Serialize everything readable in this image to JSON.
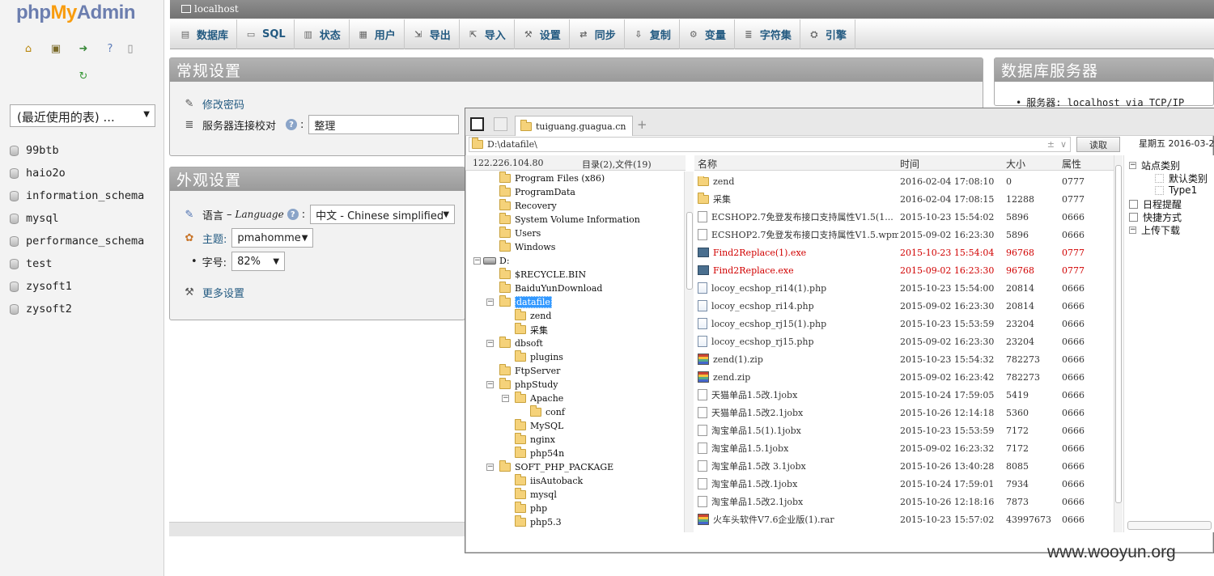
{
  "nav": {
    "logo_php": "php",
    "logo_my": "My",
    "logo_admin": "Admin",
    "recent_tables": "(最近使用的表) ...",
    "databases": [
      "99btb",
      "haio2o",
      "information_schema",
      "mysql",
      "performance_schema",
      "test",
      "zysoft1",
      "zysoft2"
    ],
    "icons": [
      "home-icon",
      "logout-icon",
      "query-window-icon",
      "help-icon",
      "docs-icon",
      "reload-icon"
    ]
  },
  "server_bar": {
    "label": "localhost"
  },
  "tabs": [
    "数据库",
    "SQL",
    "状态",
    "用户",
    "导出",
    "导入",
    "设置",
    "同步",
    "复制",
    "变量",
    "字符集",
    "引擎"
  ],
  "general": {
    "title": "常规设置",
    "change_password": "修改密码",
    "collation_label": "服务器连接校对",
    "collation_value": "整理"
  },
  "appearance": {
    "title": "外观设置",
    "language_label": "语言",
    "language_latin": "Language",
    "language_value": "中文 - Chinese simplified",
    "theme_label": "主题:",
    "theme_value": "pmahomme",
    "font_label": "字号:",
    "font_value": "82%",
    "more_settings": "更多设置"
  },
  "dbserver": {
    "title": "数据库服务器",
    "server_line": "服务器: localhost via TCP/IP"
  },
  "filemanager": {
    "tab_label": "tuiguang.guagua.cn",
    "path": "D:\\datafile\\",
    "read_button": "读取",
    "date_label": "星期五 2016-03-2",
    "ip": "122.226.104.80",
    "counts": "目录(2),文件(19)",
    "columns": {
      "name": "名称",
      "time": "时间",
      "size": "大小",
      "attr": "属性"
    },
    "tree": [
      {
        "label": "Program Files (x86)",
        "depth": 1,
        "kind": "folder"
      },
      {
        "label": "ProgramData",
        "depth": 1,
        "kind": "folder"
      },
      {
        "label": "Recovery",
        "depth": 1,
        "kind": "folder"
      },
      {
        "label": "System Volume Information",
        "depth": 1,
        "kind": "folder"
      },
      {
        "label": "Users",
        "depth": 1,
        "kind": "folder"
      },
      {
        "label": "Windows",
        "depth": 1,
        "kind": "folder"
      },
      {
        "label": "D:",
        "depth": 0,
        "kind": "drive",
        "toggle": "−"
      },
      {
        "label": "$RECYCLE.BIN",
        "depth": 1,
        "kind": "folder"
      },
      {
        "label": "BaiduYunDownload",
        "depth": 1,
        "kind": "folder"
      },
      {
        "label": "datafile",
        "depth": 1,
        "kind": "folder",
        "toggle": "−",
        "selected": true
      },
      {
        "label": "zend",
        "depth": 2,
        "kind": "folder"
      },
      {
        "label": "采集",
        "depth": 2,
        "kind": "folder"
      },
      {
        "label": "dbsoft",
        "depth": 1,
        "kind": "folder",
        "toggle": "−"
      },
      {
        "label": "plugins",
        "depth": 2,
        "kind": "folder"
      },
      {
        "label": "FtpServer",
        "depth": 1,
        "kind": "folder"
      },
      {
        "label": "phpStudy",
        "depth": 1,
        "kind": "folder",
        "toggle": "−"
      },
      {
        "label": "Apache",
        "depth": 2,
        "kind": "folder",
        "toggle": "−"
      },
      {
        "label": "conf",
        "depth": 3,
        "kind": "folder"
      },
      {
        "label": "MySQL",
        "depth": 2,
        "kind": "folder"
      },
      {
        "label": "nginx",
        "depth": 2,
        "kind": "folder"
      },
      {
        "label": "php54n",
        "depth": 2,
        "kind": "folder"
      },
      {
        "label": "SOFT_PHP_PACKAGE",
        "depth": 1,
        "kind": "folder",
        "toggle": "−"
      },
      {
        "label": "iisAutoback",
        "depth": 2,
        "kind": "folder"
      },
      {
        "label": "mysql",
        "depth": 2,
        "kind": "folder"
      },
      {
        "label": "php",
        "depth": 2,
        "kind": "folder"
      },
      {
        "label": "php5.3",
        "depth": 2,
        "kind": "folder"
      }
    ],
    "files": [
      {
        "name": "zend",
        "time": "2016-02-04 17:08:10",
        "size": "0",
        "attr": "0777",
        "type": "folder"
      },
      {
        "name": "采集",
        "time": "2016-02-04 17:08:15",
        "size": "12288",
        "attr": "0777",
        "type": "folder"
      },
      {
        "name": "ECSHOP2.7免登发布接口支持属性V1.5(1...",
        "time": "2015-10-23 15:54:02",
        "size": "5896",
        "attr": "0666",
        "type": "file"
      },
      {
        "name": "ECSHOP2.7免登发布接口支持属性V1.5.wpm",
        "time": "2015-09-02 16:23:30",
        "size": "5896",
        "attr": "0666",
        "type": "file"
      },
      {
        "name": "Find2Replace(1).exe",
        "time": "2015-10-23 15:54:04",
        "size": "96768",
        "attr": "0777",
        "type": "exe",
        "red": true
      },
      {
        "name": "Find2Replace.exe",
        "time": "2015-09-02 16:23:30",
        "size": "96768",
        "attr": "0777",
        "type": "exe",
        "red": true
      },
      {
        "name": "locoy_ecshop_ri14(1).php",
        "time": "2015-10-23 15:54:00",
        "size": "20814",
        "attr": "0666",
        "type": "php"
      },
      {
        "name": "locoy_ecshop_ri14.php",
        "time": "2015-09-02 16:23:30",
        "size": "20814",
        "attr": "0666",
        "type": "php"
      },
      {
        "name": "locoy_ecshop_rj15(1).php",
        "time": "2015-10-23 15:53:59",
        "size": "23204",
        "attr": "0666",
        "type": "php"
      },
      {
        "name": "locoy_ecshop_rj15.php",
        "time": "2015-09-02 16:23:30",
        "size": "23204",
        "attr": "0666",
        "type": "php"
      },
      {
        "name": "zend(1).zip",
        "time": "2015-10-23 15:54:32",
        "size": "782273",
        "attr": "0666",
        "type": "zip"
      },
      {
        "name": "zend.zip",
        "time": "2015-09-02 16:23:42",
        "size": "782273",
        "attr": "0666",
        "type": "zip"
      },
      {
        "name": "天猫单品1.5改.1jobx",
        "time": "2015-10-24 17:59:05",
        "size": "5419",
        "attr": "0666",
        "type": "file"
      },
      {
        "name": "天猫单品1.5改2.1jobx",
        "time": "2015-10-26 12:14:18",
        "size": "5360",
        "attr": "0666",
        "type": "file"
      },
      {
        "name": "淘宝单品1.5(1).1jobx",
        "time": "2015-10-23 15:53:59",
        "size": "7172",
        "attr": "0666",
        "type": "file"
      },
      {
        "name": "淘宝单品1.5.1jobx",
        "time": "2015-09-02 16:23:32",
        "size": "7172",
        "attr": "0666",
        "type": "file"
      },
      {
        "name": "淘宝单品1.5改 3.1jobx",
        "time": "2015-10-26 13:40:28",
        "size": "8085",
        "attr": "0666",
        "type": "file"
      },
      {
        "name": "淘宝单品1.5改.1jobx",
        "time": "2015-10-24 17:59:01",
        "size": "7934",
        "attr": "0666",
        "type": "file"
      },
      {
        "name": "淘宝单品1.5改2.1jobx",
        "time": "2015-10-26 12:18:16",
        "size": "7873",
        "attr": "0666",
        "type": "file"
      },
      {
        "name": "火车头软件V7.6企业版(1).rar",
        "time": "2015-10-23 15:57:02",
        "size": "43997673",
        "attr": "0666",
        "type": "zip"
      }
    ],
    "side": [
      {
        "label": "站点类别",
        "kind": "toggle",
        "depth": 0
      },
      {
        "label": "默认类别",
        "kind": "box",
        "depth": 1
      },
      {
        "label": "Type1",
        "kind": "box",
        "depth": 1
      },
      {
        "label": "日程提醒",
        "kind": "icon",
        "depth": 0
      },
      {
        "label": "快捷方式",
        "kind": "icon",
        "depth": 0
      },
      {
        "label": "上传下载",
        "kind": "toggle",
        "depth": 0
      }
    ]
  },
  "watermark": "www.wooyun.org",
  "colors": {
    "link": "#235a81",
    "accent_orange": "#f89c0e",
    "selection": "#3399ff",
    "red_file": "#d10000"
  }
}
